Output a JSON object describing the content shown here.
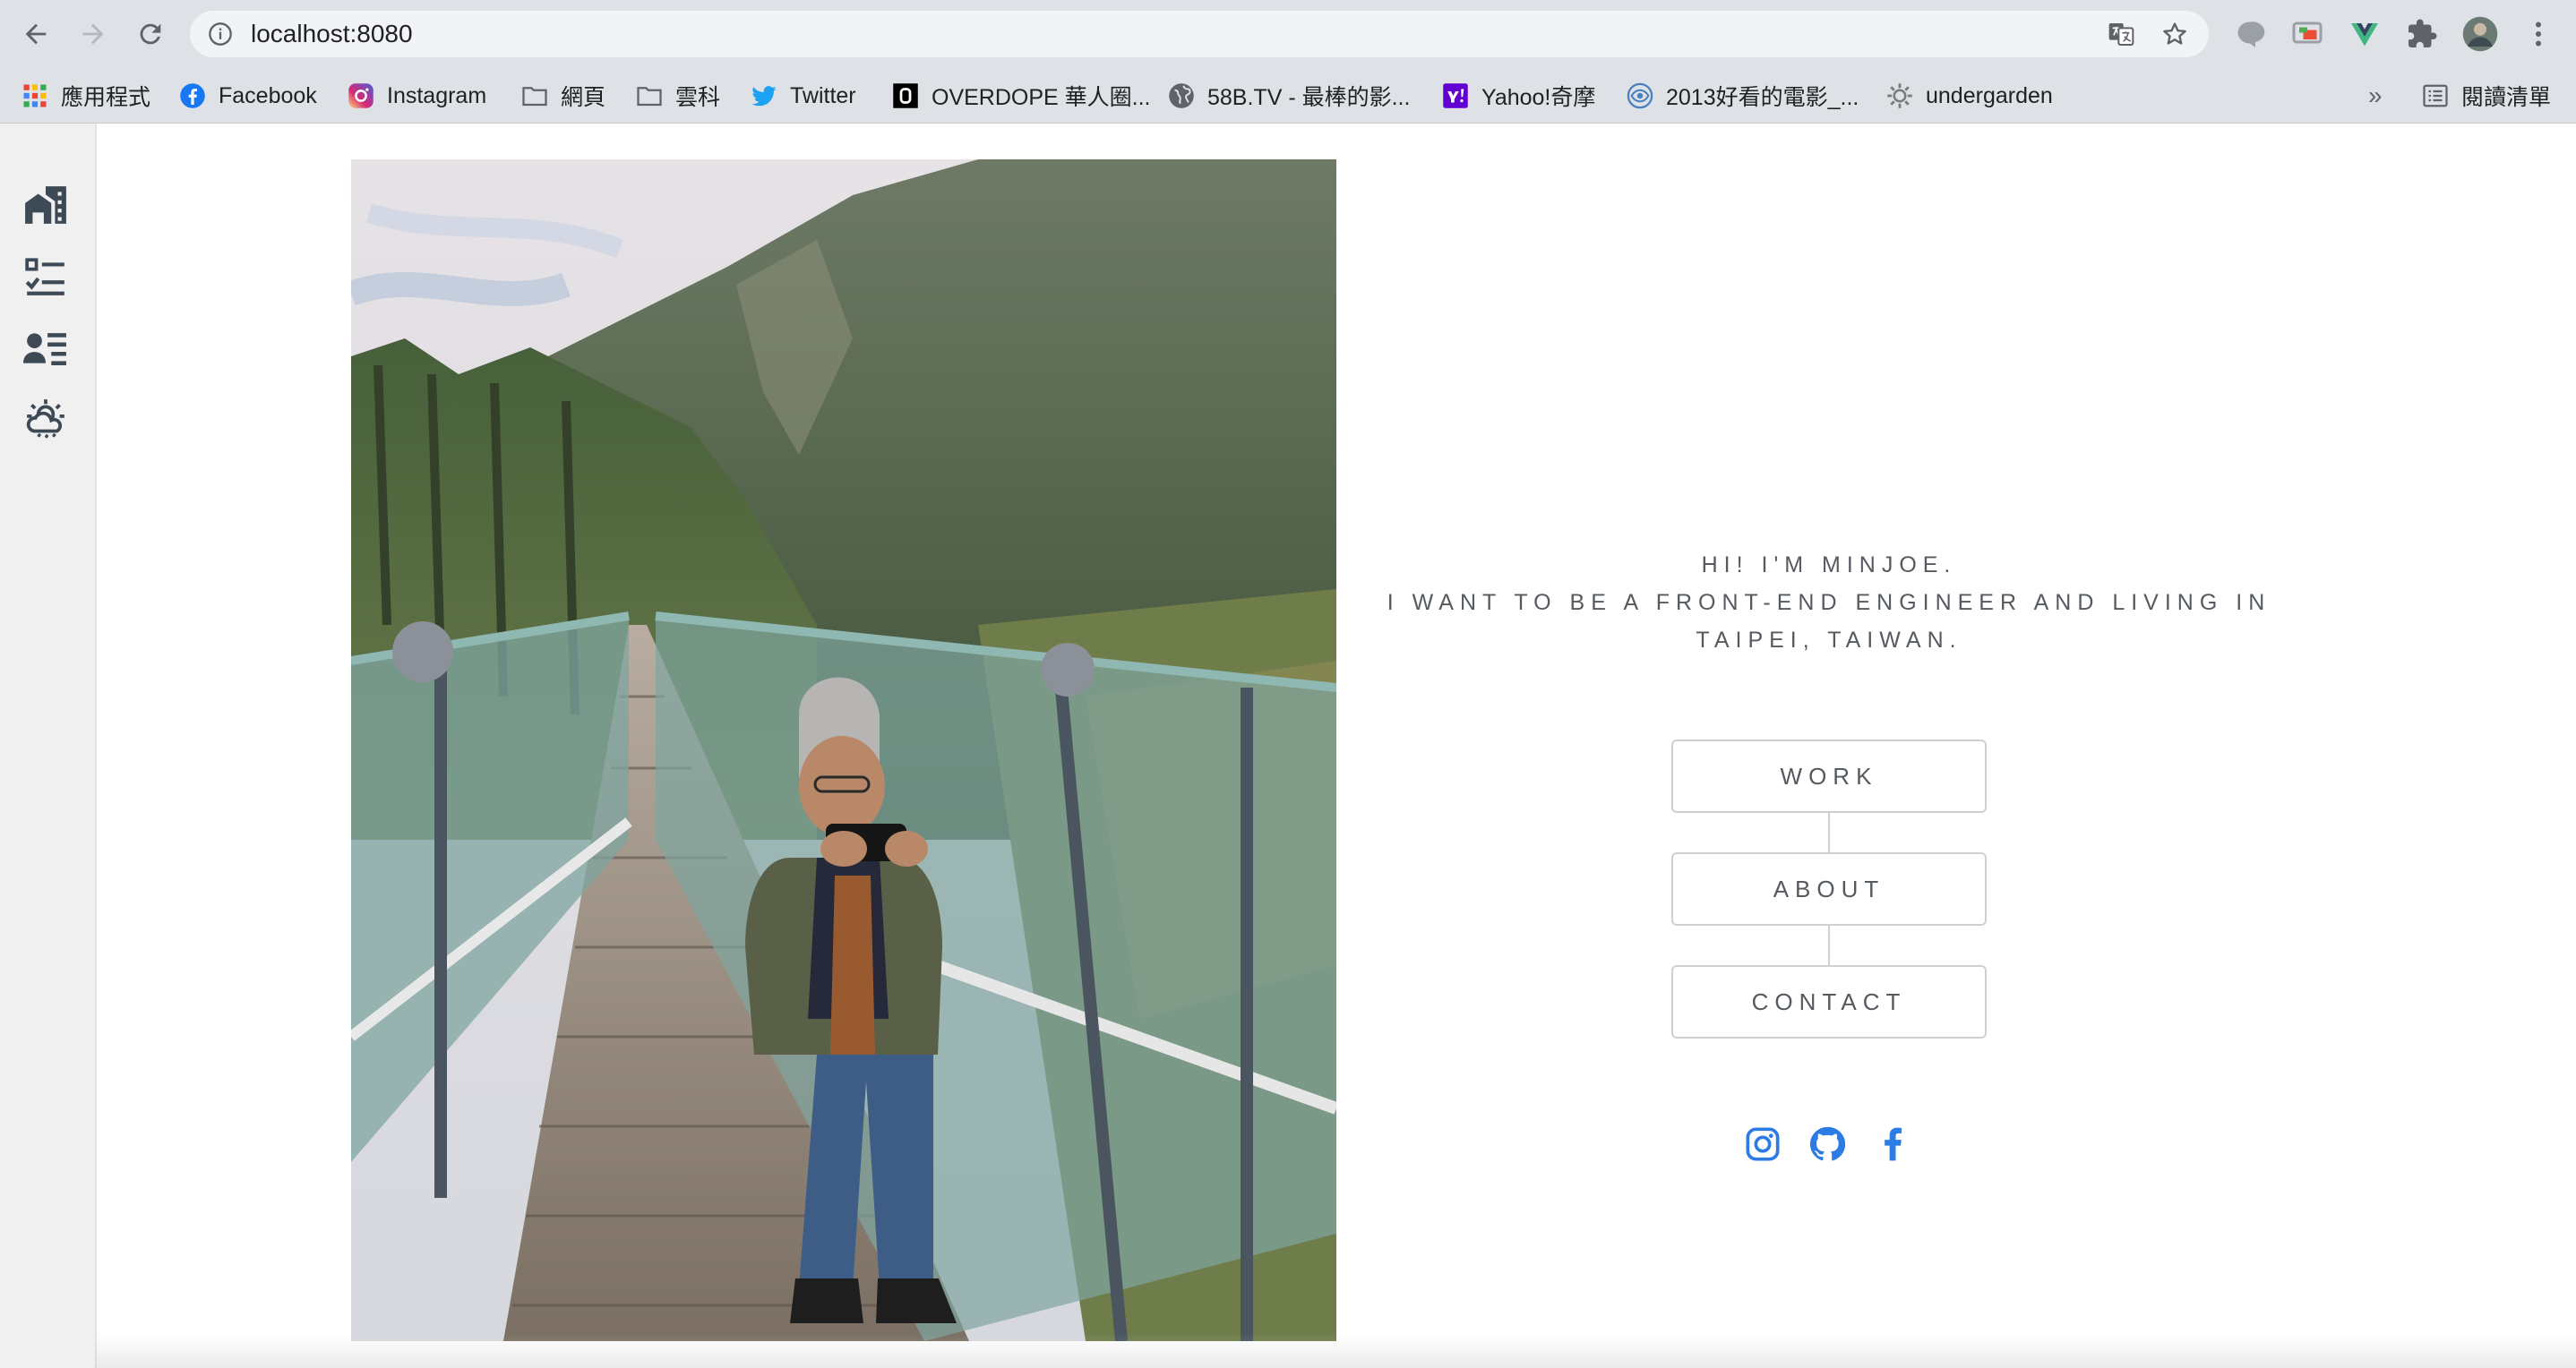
{
  "browser": {
    "url": "localhost:8080",
    "bookmarks": [
      {
        "label": "應用程式",
        "icon": "apps-grid-icon"
      },
      {
        "label": "Facebook",
        "icon": "facebook-icon"
      },
      {
        "label": "Instagram",
        "icon": "instagram-icon"
      },
      {
        "label": "網頁",
        "icon": "folder-icon"
      },
      {
        "label": "雲科",
        "icon": "folder-icon"
      },
      {
        "label": "Twitter",
        "icon": "twitter-icon"
      },
      {
        "label": "OVERDOPE 華人圈...",
        "icon": "overdope-icon"
      },
      {
        "label": "58B.TV - 最棒的影...",
        "icon": "globe-icon"
      },
      {
        "label": "Yahoo!奇摩",
        "icon": "yahoo-icon"
      },
      {
        "label": "2013好看的電影_...",
        "icon": "eye-icon"
      },
      {
        "label": "undergarden",
        "icon": "gear-icon"
      }
    ],
    "overflow_label": "»",
    "reading_list_label": "閱讀清單"
  },
  "sidebar": {
    "items": [
      {
        "icon": "buildings-icon"
      },
      {
        "icon": "checklist-icon"
      },
      {
        "icon": "user-list-icon"
      },
      {
        "icon": "weather-icon"
      }
    ]
  },
  "hero": {
    "greeting": "HI! I'M MINJOE.",
    "tagline_line1": "I WANT TO BE A FRONT-END ENGINEER AND LIVING IN",
    "tagline_line2": "TAIPEI, TAIWAN."
  },
  "menu": {
    "work": "WORK",
    "about": "ABOUT",
    "contact": "CONTACT"
  },
  "social": {
    "icons": [
      "instagram-icon",
      "github-icon",
      "facebook-icon"
    ],
    "color": "#2d7be5"
  },
  "colors": {
    "chrome_bg": "#dee1e6",
    "sidebar_bg": "#f0f0f0",
    "text_gray": "#555a60"
  }
}
